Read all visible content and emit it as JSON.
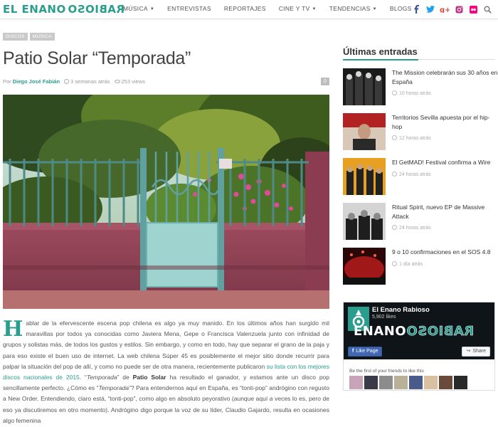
{
  "nav": {
    "logo_left": "EL ENANO",
    "logo_right": "RABIOSO",
    "menu": [
      {
        "label": "MÚSICA",
        "dropdown": true
      },
      {
        "label": "ENTREVISTAS",
        "dropdown": false
      },
      {
        "label": "REPORTAJES",
        "dropdown": false
      },
      {
        "label": "CINE Y TV",
        "dropdown": true
      },
      {
        "label": "TENDENCIAS",
        "dropdown": true
      },
      {
        "label": "BLOGS",
        "dropdown": true
      }
    ],
    "social": [
      {
        "icon": "facebook-icon",
        "color": "#3b5998"
      },
      {
        "icon": "twitter-icon",
        "color": "#1da1f2"
      },
      {
        "icon": "google-plus-icon",
        "color": "#dd4b39"
      },
      {
        "icon": "instagram-icon",
        "color": "#c13584"
      },
      {
        "icon": "flickr-icon",
        "color": "#ff0084"
      },
      {
        "icon": "search-icon",
        "color": "#777777"
      }
    ]
  },
  "breadcrumb": [
    "DISCOS",
    "MÚSICA"
  ],
  "post": {
    "title": "Patio Solar “Temporada”",
    "author_prefix": "Por",
    "author": "Diego José Fabián",
    "date": "3 semanas atrás",
    "views": "253 views",
    "comments": "0"
  },
  "article": {
    "dropcap": "H",
    "p1": "ablar de la efervescente escena pop chilena es algo ya muy manido. En los últimos años han surgido mil maravillas por todos ya conocidas como Javiera Mena, Gepe o Francisca Valenzuela junto con infinidad de grupos y solistas más, de todos los gustos y estilos. Sin embargo, y como en todo, hay que separar el grano de la paja y para eso existe el buen uso de internet. La web chilena Súper 45 es posiblemente el mejor sitio donde recurrir para palpar la situación del pop de allí, y como no puede ser de otra manera, recientemente publicaron ",
    "link": "su lista con los mejores discos nacionales de 2015",
    "p2": ". “",
    "em1": "Temporada",
    "p3": "” de ",
    "bold1": "Patio Solar",
    "p4": " ha resultado el ganador, y estamos ante un disco pop sencillamente perfecto. ¿Cómo es “",
    "em2": "Temporada",
    "p5": "”? Para entendernos aquí en España, es “tonti-pop” andrógino con regusto a New Order. Entendiendo, claro está, “tonti-pop”, como algo en absoluto peyorativo (aunque aquí a veces lo es, pero de eso ya discutiremos en otro momento). Andrógino digo porque la voz de su líder, Claudio Gajardo, resulta en ocasiones algo femenina"
  },
  "sidebar": {
    "title": "Últimas entradas",
    "entries": [
      {
        "title": "The Mission celebrarán sus 30 años en España",
        "time": "10 horas atrás"
      },
      {
        "title": "Territorios Sevilla apuesta por el hip-hop",
        "time": "12 horas atrás"
      },
      {
        "title": "El GetMAD! Festival confirma a Wire",
        "time": "24 horas atrás"
      },
      {
        "title": "Ritual Spirit, nuevo EP de Massive Attack",
        "time": "24 horas atrás"
      },
      {
        "title": "9 o 10 confirmaciones en el SOS 4.8",
        "time": "1 día atrás"
      }
    ]
  },
  "facebook": {
    "page_name": "El Enano Rabioso",
    "likes": "5,902 likes",
    "brand_left": "ENANO",
    "brand_right": "RABIOSO",
    "like_button": "Like Page",
    "share_button": "Share",
    "friends_text": "Be the first of your friends to like this"
  }
}
